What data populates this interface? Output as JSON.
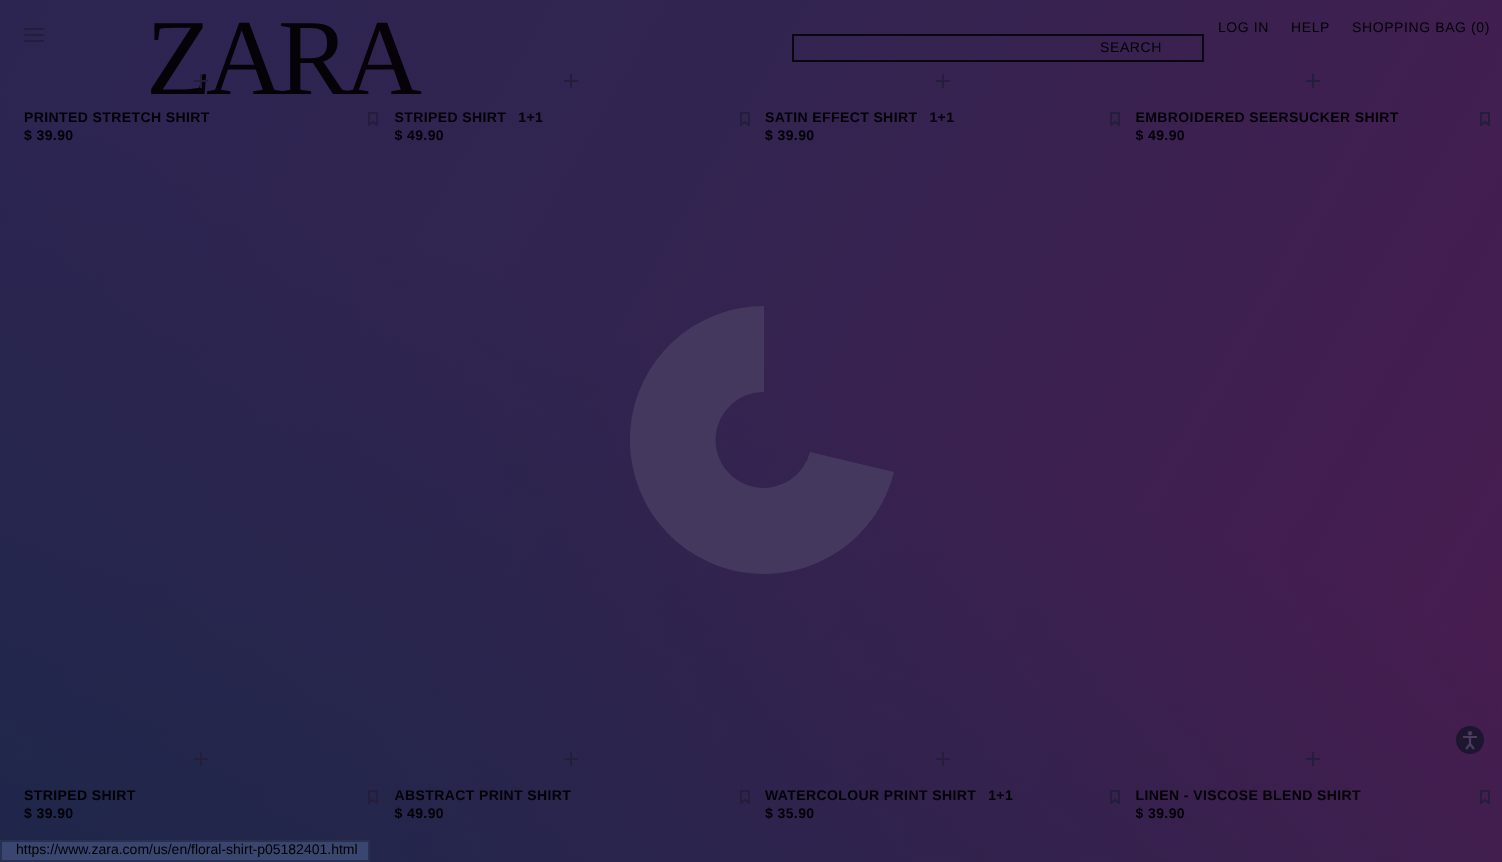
{
  "header": {
    "logo": "ZARA",
    "search": {
      "button": "SEARCH"
    },
    "nav": [
      "LOG IN",
      "HELP",
      "SHOPPING BAG (0)"
    ]
  },
  "products": [
    {
      "name": "PRINTED STRETCH SHIRT",
      "price": "$ 39.90"
    },
    {
      "name": "STRIPED SHIRT",
      "badge": "1+1",
      "price": "$ 49.90"
    },
    {
      "name": "SATIN EFFECT SHIRT",
      "badge": "1+1",
      "price": "$ 39.90"
    },
    {
      "name": "EMBROIDERED SEERSUCKER SHIRT",
      "price": "$ 49.90"
    },
    {
      "name": "STRIPED SHIRT",
      "price": "$ 39.90"
    },
    {
      "name": "ABSTRACT PRINT SHIRT",
      "price": "$ 49.90"
    },
    {
      "name": "WATERCOLOUR PRINT SHIRT",
      "badge": "1+1",
      "price": "$ 35.90"
    },
    {
      "name": "LINEN - VISCOSE BLEND SHIRT",
      "price": "$ 39.90"
    }
  ],
  "status_bar": {
    "url": "https://www.zara.com/us/en/floral-shirt-p05182401.html"
  }
}
